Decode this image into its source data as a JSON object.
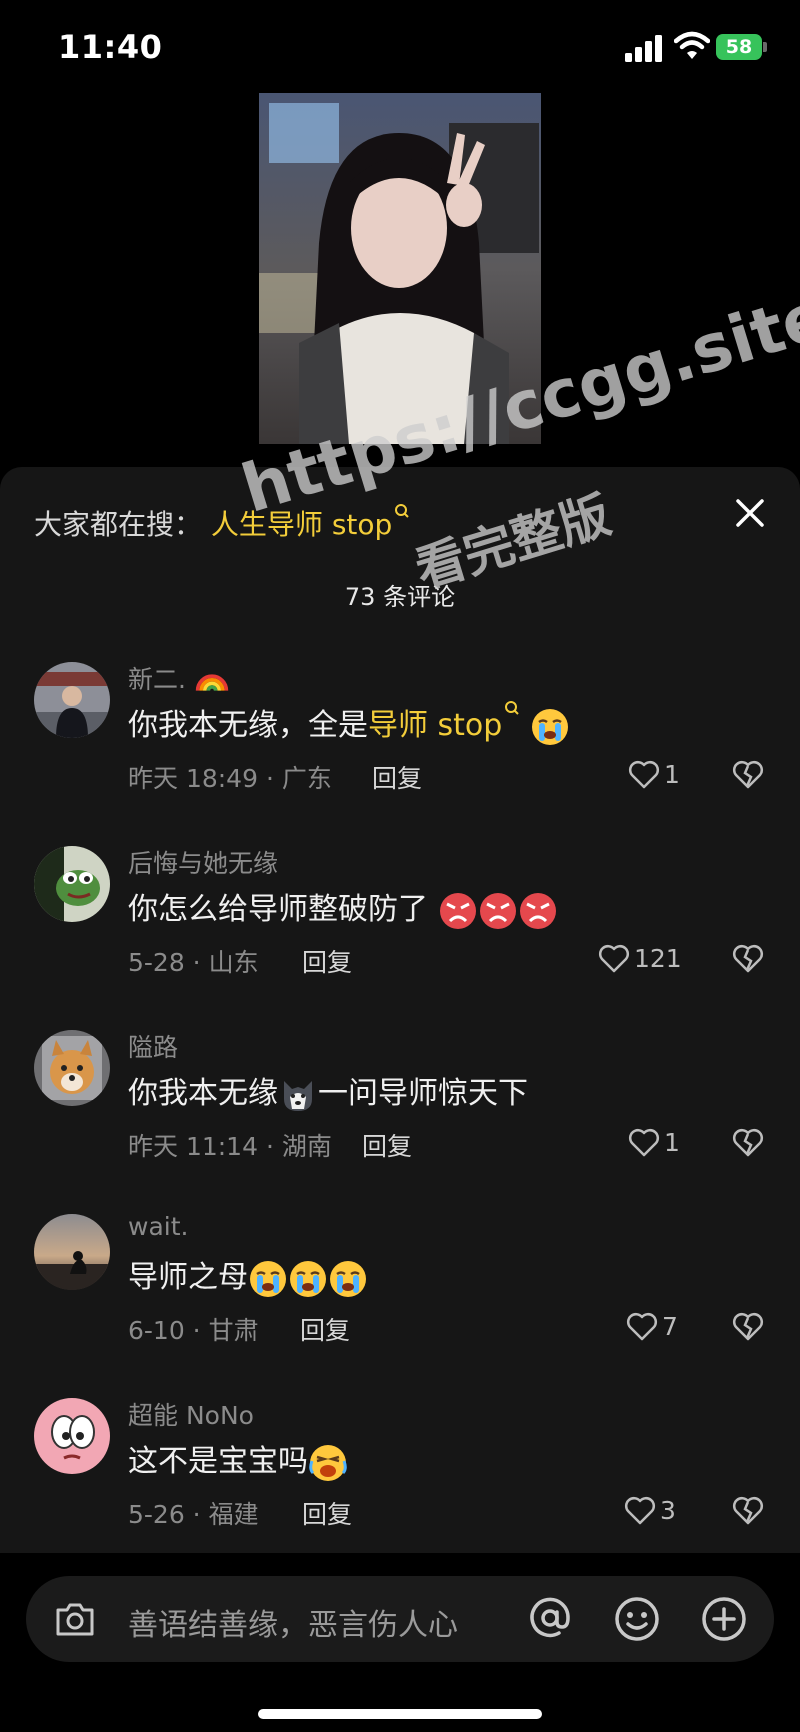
{
  "status": {
    "time": "11:40",
    "battery": "58"
  },
  "sheet": {
    "hot_prefix": "大家都在搜：",
    "hot_link": "人生导师 stop",
    "comment_count": "73 条评论"
  },
  "watermark": {
    "line1": "https://ccgg.site",
    "line2": "看完整版"
  },
  "comments": [
    {
      "user": "新二.",
      "text_a": "你我本无缘，全是",
      "text_hl": "导师 stop",
      "meta": "昨天 18:49 · 广东",
      "reply": "回复",
      "likes": "1"
    },
    {
      "user": "后悔与她无缘",
      "text_a": "你怎么给导师整破防了",
      "meta": "5-28 · 山东",
      "reply": "回复",
      "likes": "121"
    },
    {
      "user": "隘路",
      "text_a": "你我本无缘",
      "text_b": "一问导师惊天下",
      "meta": "昨天 11:14 · 湖南",
      "reply": "回复",
      "likes": "1"
    },
    {
      "user": "wait.",
      "text_a": "导师之母",
      "meta": "6-10 · 甘肃",
      "reply": "回复",
      "likes": "7"
    },
    {
      "user": "超能 NoNo",
      "text_a": "这不是宝宝吗",
      "meta": "5-26 · 福建",
      "reply": "回复",
      "likes": "3"
    }
  ],
  "input": {
    "placeholder": "善语结善缘，恶言伤人心"
  },
  "icons": [
    "camera-icon",
    "at-icon",
    "emoji-icon",
    "plus-icon",
    "heart-icon",
    "dislike-icon",
    "close-icon",
    "search-icon"
  ]
}
